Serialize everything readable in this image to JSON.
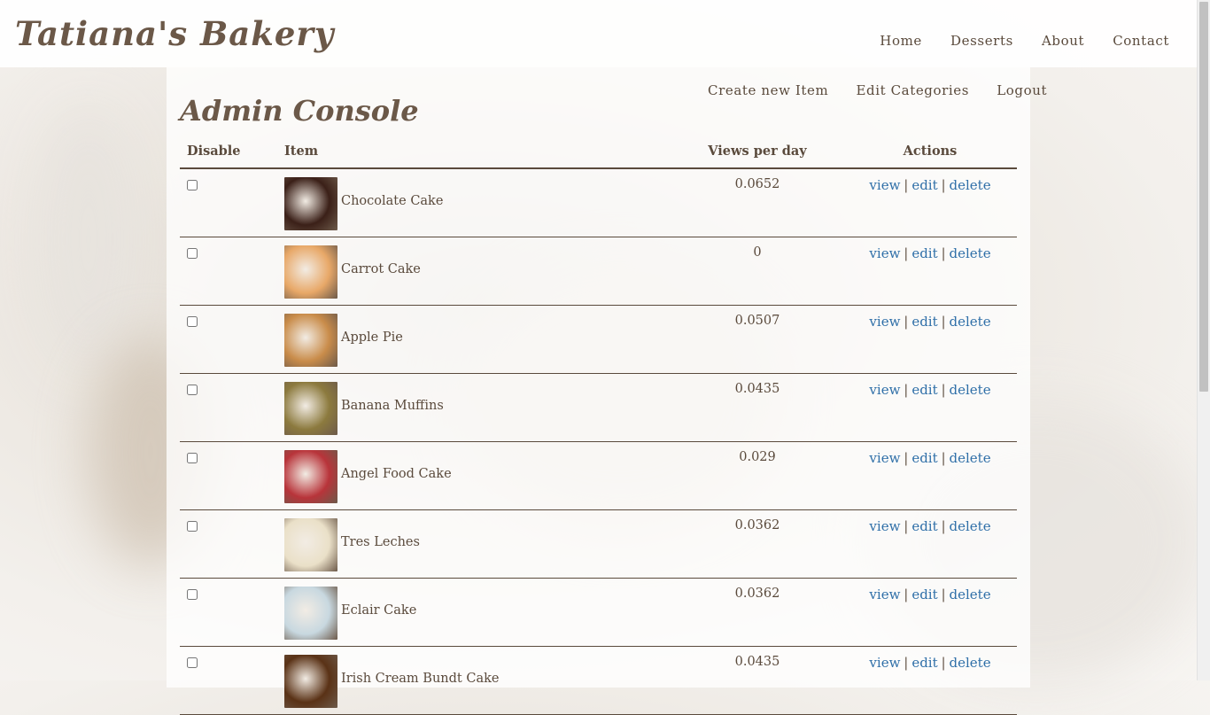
{
  "brand": "Tatiana's Bakery",
  "main_nav": [
    "Home",
    "Desserts",
    "About",
    "Contact"
  ],
  "admin_nav": [
    "Create new Item",
    "Edit Categories",
    "Logout"
  ],
  "page_title": "Admin Console",
  "table": {
    "headers": {
      "disable": "Disable",
      "item": "Item",
      "views": "Views per day",
      "actions": "Actions"
    },
    "action_labels": {
      "view": "view",
      "edit": "edit",
      "delete": "delete",
      "sep": "|"
    },
    "rows": [
      {
        "name": "Chocolate Cake",
        "views": "0.0652",
        "disabled": false,
        "thumb": "#3b2018"
      },
      {
        "name": "Carrot Cake",
        "views": "0",
        "disabled": false,
        "thumb": "#e8a868"
      },
      {
        "name": "Apple Pie",
        "views": "0.0507",
        "disabled": false,
        "thumb": "#c98c4a"
      },
      {
        "name": "Banana Muffins",
        "views": "0.0435",
        "disabled": false,
        "thumb": "#8c7a3e"
      },
      {
        "name": "Angel Food Cake",
        "views": "0.029",
        "disabled": false,
        "thumb": "#b8343a"
      },
      {
        "name": "Tres Leches",
        "views": "0.0362",
        "disabled": false,
        "thumb": "#eae0c8"
      },
      {
        "name": "Eclair Cake",
        "views": "0.0362",
        "disabled": false,
        "thumb": "#c8d8e0"
      },
      {
        "name": "Irish Cream Bundt Cake",
        "views": "0.0435",
        "disabled": false,
        "thumb": "#5a3216"
      }
    ]
  },
  "colors": {
    "link": "#2f6fa8",
    "text": "#5a4a3c",
    "heading": "#6b5848"
  }
}
